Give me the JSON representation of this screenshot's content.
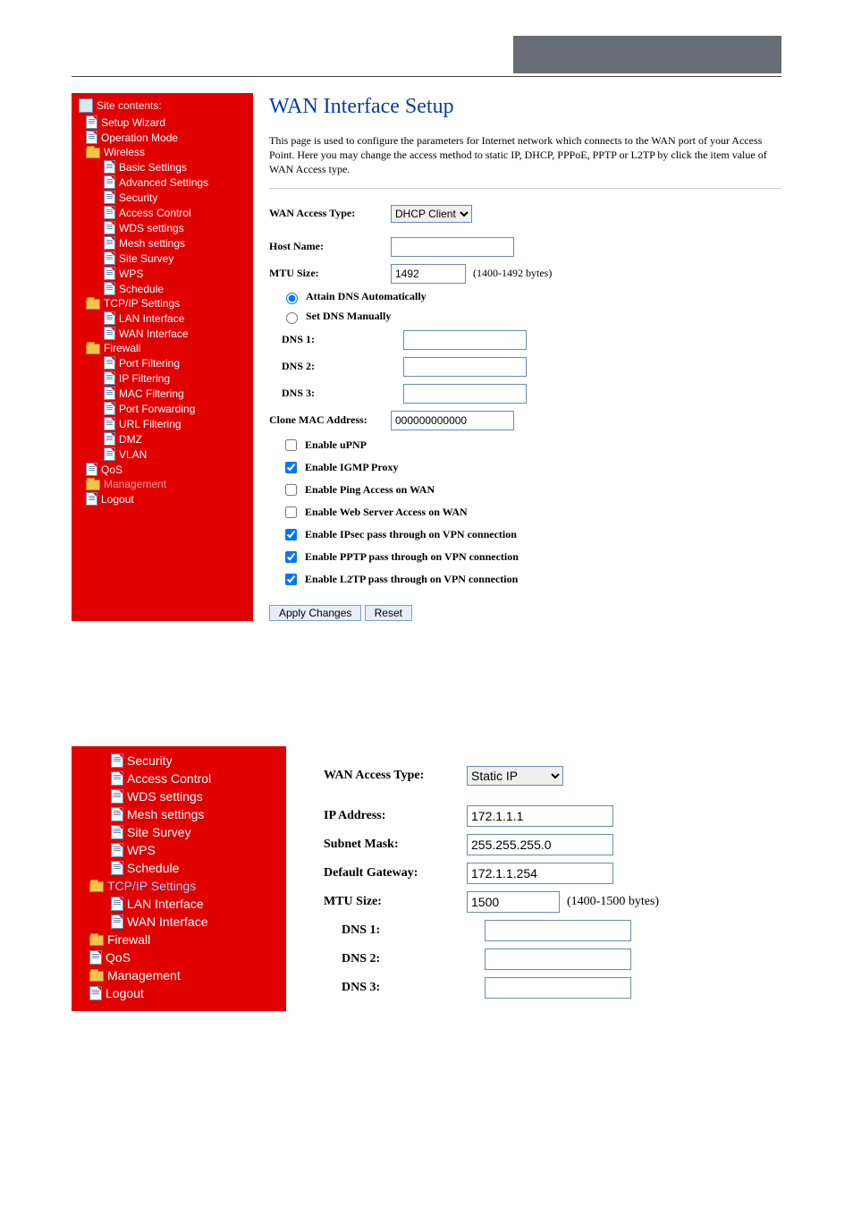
{
  "header": {},
  "sidebar": {
    "title": "Site contents:",
    "items": [
      {
        "label": "Setup Wizard",
        "icon": "page",
        "lv": 0
      },
      {
        "label": "Operation Mode",
        "icon": "page",
        "lv": 0
      },
      {
        "label": "Wireless",
        "icon": "folder",
        "lv": 0
      },
      {
        "label": "Basic Settings",
        "icon": "page",
        "lv": 1
      },
      {
        "label": "Advanced Settings",
        "icon": "page",
        "lv": 1
      },
      {
        "label": "Security",
        "icon": "page",
        "lv": 1
      },
      {
        "label": "Access Control",
        "icon": "page",
        "lv": 1
      },
      {
        "label": "WDS settings",
        "icon": "page",
        "lv": 1
      },
      {
        "label": "Mesh settings",
        "icon": "page",
        "lv": 1
      },
      {
        "label": "Site Survey",
        "icon": "page",
        "lv": 1
      },
      {
        "label": "WPS",
        "icon": "page",
        "lv": 1
      },
      {
        "label": "Schedule",
        "icon": "page",
        "lv": 1
      },
      {
        "label": "TCP/IP Settings",
        "icon": "folder",
        "lv": 0
      },
      {
        "label": "LAN Interface",
        "icon": "page",
        "lv": 1
      },
      {
        "label": "WAN Interface",
        "icon": "page",
        "lv": 1
      },
      {
        "label": "Firewall",
        "icon": "folder",
        "lv": 0
      },
      {
        "label": "Port Filtering",
        "icon": "page",
        "lv": 1
      },
      {
        "label": "IP Filtering",
        "icon": "page",
        "lv": 1
      },
      {
        "label": "MAC Filtering",
        "icon": "page",
        "lv": 1
      },
      {
        "label": "Port Forwarding",
        "icon": "page",
        "lv": 1
      },
      {
        "label": "URL Filtering",
        "icon": "page",
        "lv": 1
      },
      {
        "label": "DMZ",
        "icon": "page",
        "lv": 1
      },
      {
        "label": "VLAN",
        "icon": "page",
        "lv": 1
      },
      {
        "label": "QoS",
        "icon": "page",
        "lv": 0
      },
      {
        "label": "Management",
        "icon": "folder",
        "lv": 0,
        "dim": true
      },
      {
        "label": "Logout",
        "icon": "page",
        "lv": 0
      }
    ]
  },
  "main": {
    "title": "WAN Interface Setup",
    "description": "This page is used to configure the parameters for Internet network which connects to the WAN port of your Access Point. Here you may change the access method to static IP, DHCP, PPPoE, PPTP or L2TP by click the item value of WAN Access type.",
    "wan_access_label": "WAN Access Type:",
    "wan_access_value": "DHCP Client",
    "host_name_label": "Host Name:",
    "host_name_value": "",
    "mtu_label": "MTU Size:",
    "mtu_value": "1492",
    "mtu_hint": "(1400-1492 bytes)",
    "dns_auto_label": "Attain DNS Automatically",
    "dns_manual_label": "Set DNS Manually",
    "dns1_label": "DNS 1:",
    "dns1_value": "",
    "dns2_label": "DNS 2:",
    "dns2_value": "",
    "dns3_label": "DNS 3:",
    "dns3_value": "",
    "clone_mac_label": "Clone MAC Address:",
    "clone_mac_value": "000000000000",
    "cb_upnp": "Enable uPNP",
    "cb_igmp": "Enable IGMP Proxy",
    "cb_ping": "Enable Ping Access on WAN",
    "cb_web": "Enable Web Server Access on WAN",
    "cb_ipsec": "Enable IPsec pass through on VPN connection",
    "cb_pptp": "Enable PPTP pass through on VPN connection",
    "cb_l2tp": "Enable L2TP pass through on VPN connection",
    "apply_label": "Apply Changes",
    "reset_label": "Reset"
  },
  "sidebar2": {
    "items": [
      {
        "label": "Security",
        "icon": "page",
        "lv": 1
      },
      {
        "label": "Access Control",
        "icon": "page",
        "lv": 1
      },
      {
        "label": "WDS settings",
        "icon": "page",
        "lv": 1
      },
      {
        "label": "Mesh settings",
        "icon": "page",
        "lv": 1
      },
      {
        "label": "Site Survey",
        "icon": "page",
        "lv": 1
      },
      {
        "label": "WPS",
        "icon": "page",
        "lv": 1
      },
      {
        "label": "Schedule",
        "icon": "page",
        "lv": 1
      },
      {
        "label": "TCP/IP Settings",
        "icon": "folder",
        "lv": 0,
        "active": true
      },
      {
        "label": "LAN Interface",
        "icon": "page",
        "lv": 1
      },
      {
        "label": "WAN Interface",
        "icon": "page",
        "lv": 1
      },
      {
        "label": "Firewall",
        "icon": "folder",
        "lv": 0
      },
      {
        "label": "QoS",
        "icon": "page",
        "lv": 0
      },
      {
        "label": "Management",
        "icon": "folder",
        "lv": 0
      },
      {
        "label": "Logout",
        "icon": "page",
        "lv": 0
      }
    ]
  },
  "static": {
    "wan_access_label": "WAN Access Type:",
    "wan_access_value": "Static IP",
    "ip_label": "IP Address:",
    "ip_value": "172.1.1.1",
    "mask_label": "Subnet Mask:",
    "mask_value": "255.255.255.0",
    "gw_label": "Default Gateway:",
    "gw_value": "172.1.1.254",
    "mtu_label": "MTU Size:",
    "mtu_value": "1500",
    "mtu_hint": "(1400-1500 bytes)",
    "dns1_label": "DNS 1:",
    "dns1_value": "",
    "dns2_label": "DNS 2:",
    "dns2_value": "",
    "dns3_label": "DNS 3:",
    "dns3_value": ""
  }
}
